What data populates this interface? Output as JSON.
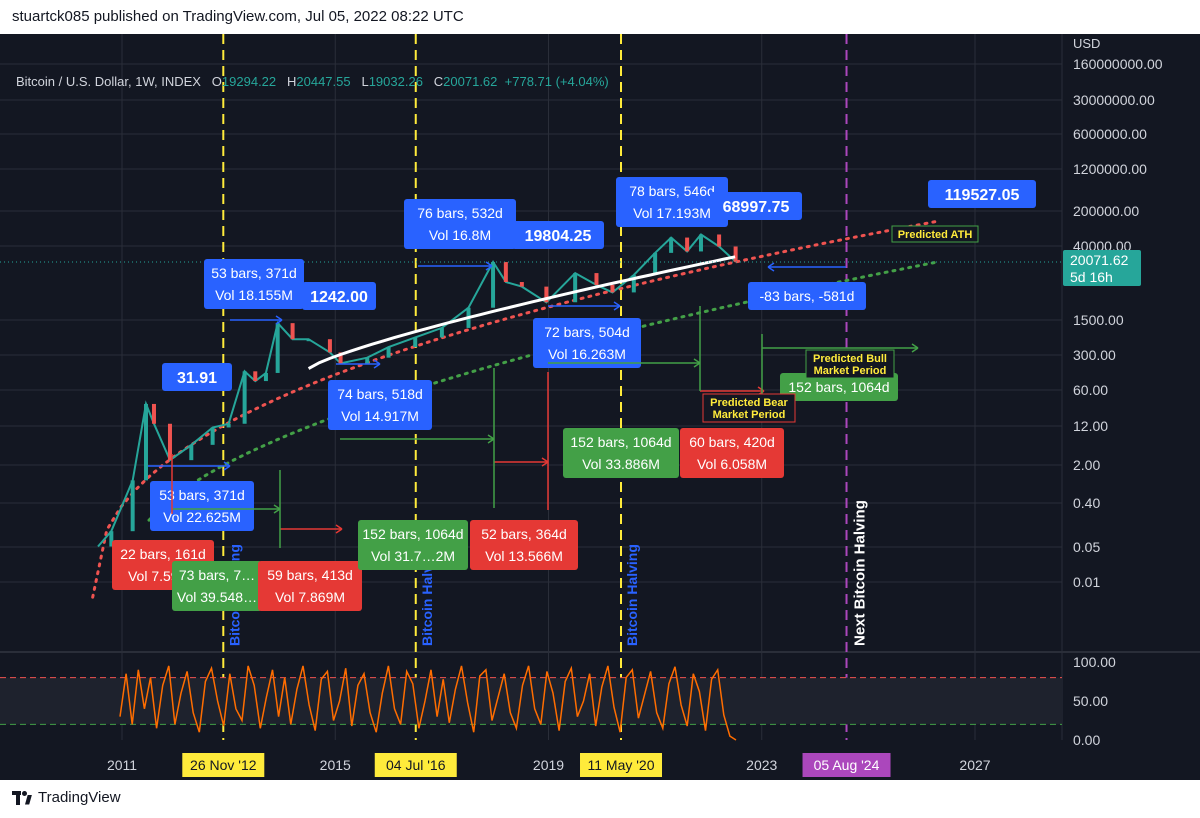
{
  "header": {
    "publisher": "stuartck085 published on TradingView.com, Jul 05, 2022 08:22 UTC"
  },
  "footer": {
    "brand": "TradingView"
  },
  "legend": {
    "symbol": "Bitcoin / U.S. Dollar, 1W, INDEX",
    "o_label": "O",
    "o": "19294.22",
    "h_label": "H",
    "h": "20447.55",
    "l_label": "L",
    "l": "19032.26",
    "c_label": "C",
    "c": "20071.62",
    "change": "+778.71 (+4.04%)"
  },
  "colors": {
    "background": "#131722",
    "grid": "#2a2e39",
    "text": "#d1d4dc",
    "blue_label": "#2962ff",
    "green_label": "#43a047",
    "red_label": "#e53935",
    "halving_line": "#ffeb3b",
    "next_halving_line": "#ab47bc",
    "ath_curve": "#ef5350",
    "support_curve": "#43a047",
    "moving_avg": "#ffffff",
    "oscillator": "#ff6d00",
    "candle_up": "#26a69a",
    "candle_down": "#ef5350",
    "price_marker": "#26a69a"
  },
  "chart_data": {
    "type": "line",
    "title": "Bitcoin / U.S. Dollar, 1W, INDEX",
    "y_unit": "USD",
    "y_scale": "log",
    "y_ticks": [
      "160000000.00",
      "30000000.00",
      "6000000.00",
      "1200000.00",
      "200000.00",
      "40000.00",
      "1500.00",
      "300.00",
      "60.00",
      "12.00",
      "2.00",
      "0.40",
      "0.05",
      "0.01"
    ],
    "x_ticks": [
      "2011",
      "2015",
      "2019",
      "2023",
      "2027"
    ],
    "last_price": {
      "value": "20071.62",
      "countdown": "5d 16h"
    },
    "halvings": [
      {
        "date": "26 Nov '12",
        "x": 2012.9,
        "label": "Bitcoin Halving"
      },
      {
        "date": "04 Jul '16",
        "x": 2016.51,
        "label": "Bitcoin Halving"
      },
      {
        "date": "11 May '20",
        "x": 2020.36,
        "label": "Bitcoin Halving"
      },
      {
        "date": "05 Aug '24",
        "x": 2024.59,
        "label": "Next Bitcoin Halving"
      }
    ],
    "price_series": [
      {
        "x": 2010.55,
        "y": 0.05
      },
      {
        "x": 2010.8,
        "y": 0.1
      },
      {
        "x": 2011.2,
        "y": 1.0
      },
      {
        "x": 2011.45,
        "y": 31.91
      },
      {
        "x": 2011.6,
        "y": 13
      },
      {
        "x": 2011.9,
        "y": 2.5
      },
      {
        "x": 2012.3,
        "y": 5
      },
      {
        "x": 2012.7,
        "y": 11
      },
      {
        "x": 2013.0,
        "y": 13
      },
      {
        "x": 2013.3,
        "y": 140
      },
      {
        "x": 2013.5,
        "y": 90
      },
      {
        "x": 2013.7,
        "y": 130
      },
      {
        "x": 2013.92,
        "y": 1242
      },
      {
        "x": 2014.2,
        "y": 600
      },
      {
        "x": 2014.5,
        "y": 600
      },
      {
        "x": 2014.9,
        "y": 330
      },
      {
        "x": 2015.1,
        "y": 200
      },
      {
        "x": 2015.6,
        "y": 260
      },
      {
        "x": 2016.0,
        "y": 420
      },
      {
        "x": 2016.5,
        "y": 650
      },
      {
        "x": 2017.0,
        "y": 1000
      },
      {
        "x": 2017.5,
        "y": 2500
      },
      {
        "x": 2017.96,
        "y": 19804.25
      },
      {
        "x": 2018.2,
        "y": 8000
      },
      {
        "x": 2018.5,
        "y": 6500
      },
      {
        "x": 2018.96,
        "y": 3200
      },
      {
        "x": 2019.5,
        "y": 12000
      },
      {
        "x": 2019.9,
        "y": 7000
      },
      {
        "x": 2020.2,
        "y": 5000
      },
      {
        "x": 2020.6,
        "y": 11000
      },
      {
        "x": 2021.0,
        "y": 30000
      },
      {
        "x": 2021.3,
        "y": 60000
      },
      {
        "x": 2021.6,
        "y": 32000
      },
      {
        "x": 2021.86,
        "y": 68997.75
      },
      {
        "x": 2022.2,
        "y": 40000
      },
      {
        "x": 2022.51,
        "y": 20071.62
      }
    ],
    "peak_labels": [
      {
        "x": 2011.45,
        "y": 31.91,
        "text": "31.91"
      },
      {
        "x": 2013.92,
        "y": 1242,
        "text": "1242.00"
      },
      {
        "x": 2017.96,
        "y": 19804.25,
        "text": "19804.25"
      },
      {
        "x": 2021.86,
        "y": 68997.75,
        "text": "68997.75"
      },
      {
        "x": 2025.5,
        "y": 119527.05,
        "text": "119527.05"
      }
    ],
    "measure_labels": [
      {
        "color": "blue",
        "lines": [
          "53 bars, 371d",
          "Vol 18.155M"
        ]
      },
      {
        "color": "blue",
        "lines": [
          "76 bars, 532d",
          "Vol 16.8M"
        ]
      },
      {
        "color": "blue",
        "lines": [
          "78 bars, 546d",
          "Vol 17.193M"
        ]
      },
      {
        "color": "blue",
        "lines": [
          "74 bars, 518d",
          "Vol 14.917M"
        ]
      },
      {
        "color": "blue",
        "lines": [
          "72 bars, 504d",
          "Vol 16.263M"
        ]
      },
      {
        "color": "blue",
        "lines": [
          "53 bars, 371d",
          "Vol 22.625M"
        ]
      },
      {
        "color": "blue",
        "lines": [
          "-83 bars, -581d"
        ]
      },
      {
        "color": "red",
        "lines": [
          "22 bars, 161d",
          "Vol 7.597M"
        ]
      },
      {
        "color": "green",
        "lines": [
          "73 bars, 7…",
          "Vol 39.548…"
        ]
      },
      {
        "color": "red",
        "lines": [
          "59 bars, 413d",
          "Vol 7.869M"
        ]
      },
      {
        "color": "green",
        "lines": [
          "152 bars, 1064d",
          "Vol 31.7…2M"
        ]
      },
      {
        "color": "red",
        "lines": [
          "52 bars, 364d",
          "Vol 13.566M"
        ]
      },
      {
        "color": "green",
        "lines": [
          "152 bars, 1064d",
          "Vol 33.886M"
        ]
      },
      {
        "color": "red",
        "lines": [
          "60 bars, 420d",
          "Vol 6.058M"
        ]
      },
      {
        "color": "green",
        "lines": [
          "152 bars, 1064d"
        ]
      }
    ],
    "annotations": [
      "Predicted ATH",
      "Predicted Bull Market Period",
      "Predicted Bear Market Period"
    ],
    "oscillator": {
      "y_ticks": [
        "100.00",
        "50.00",
        "0.00"
      ],
      "upper_level": 80,
      "lower_level": 20,
      "values": [
        30,
        85,
        20,
        90,
        40,
        80,
        15,
        70,
        95,
        20,
        60,
        88,
        35,
        10,
        75,
        92,
        50,
        18,
        85,
        40,
        25,
        95,
        70,
        15,
        55,
        90,
        30,
        80,
        20,
        65,
        95,
        45,
        12,
        78,
        88,
        25,
        50,
        92,
        18,
        70,
        85,
        35,
        10,
        60,
        95,
        40,
        20,
        88,
        72,
        15,
        50,
        90,
        30,
        78,
        22,
        65,
        95,
        48,
        10,
        82,
        90,
        25,
        55,
        85,
        35,
        15,
        70,
        95,
        40,
        20,
        88,
        60,
        12,
        75,
        92,
        30,
        50,
        85,
        18,
        68,
        95,
        42,
        10,
        80,
        90,
        28,
        58,
        88,
        35,
        15,
        72,
        94,
        45,
        18,
        85,
        62,
        12,
        78,
        90,
        32,
        5,
        0
      ]
    }
  }
}
